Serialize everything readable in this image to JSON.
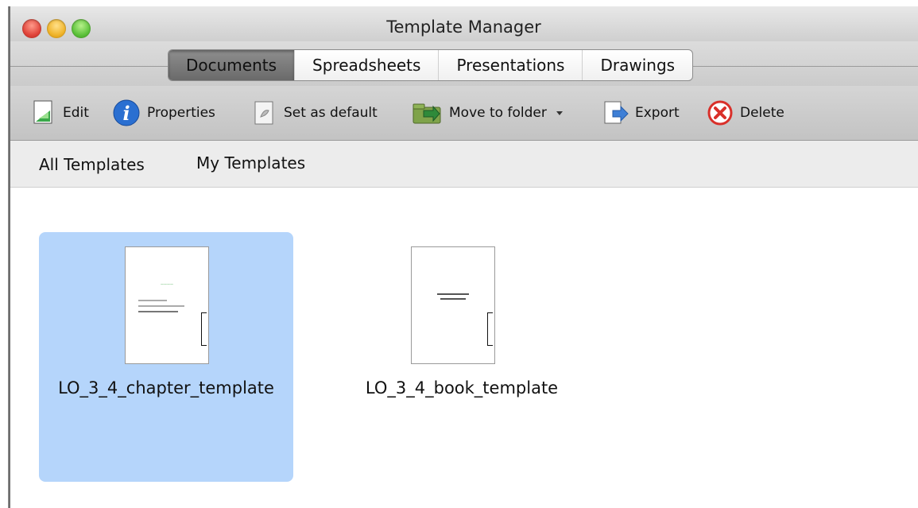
{
  "window": {
    "title": "Template Manager"
  },
  "tabs": [
    {
      "label": "Documents",
      "active": true
    },
    {
      "label": "Spreadsheets",
      "active": false
    },
    {
      "label": "Presentations",
      "active": false
    },
    {
      "label": "Drawings",
      "active": false
    }
  ],
  "toolbar": {
    "edit": "Edit",
    "properties": "Properties",
    "set_default": "Set as default",
    "move_to_folder": "Move to folder",
    "export": "Export",
    "delete": "Delete"
  },
  "regions": {
    "all": "All Templates",
    "mine": "My Templates"
  },
  "templates": [
    {
      "name": "LO_3_4_chapter_template",
      "selected": true
    },
    {
      "name": "LO_3_4_book_template",
      "selected": false
    }
  ],
  "colors": {
    "selection": "#b5d5fb",
    "active_tab": "#7a7a7a",
    "delete_red": "#d9302a",
    "properties_blue": "#2a6fd1"
  },
  "icons": [
    "edit-icon",
    "info-icon",
    "set-default-icon",
    "folder-move-icon",
    "chevron-down-icon",
    "export-icon",
    "delete-icon"
  ]
}
